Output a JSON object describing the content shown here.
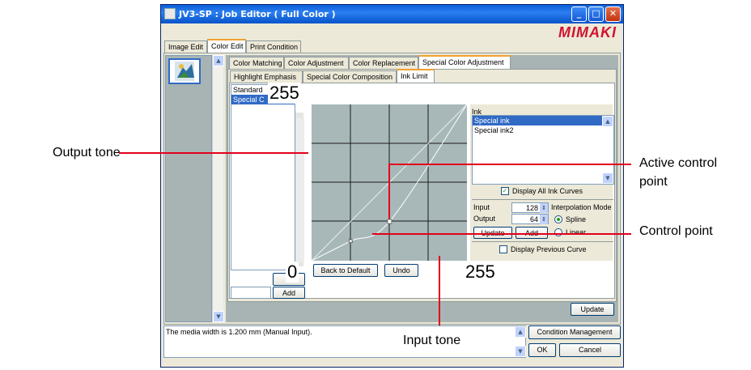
{
  "window": {
    "title": "JV3-SP : Job Editor ( Full Color )",
    "brand": "MIMAKI",
    "min_label": "_",
    "max_label": "□",
    "close_label": "✕"
  },
  "main_tabs": [
    {
      "label": "Image Edit",
      "active": false
    },
    {
      "label": "Color Edit",
      "active": true
    },
    {
      "label": "Print Condition",
      "active": false
    }
  ],
  "sub_tabs": [
    {
      "label": "Color Matching",
      "active": false
    },
    {
      "label": "Color Adjustment",
      "active": false
    },
    {
      "label": "Color Replacement",
      "active": false
    },
    {
      "label": "Special Color Adjustment",
      "active": true
    }
  ],
  "sub_sub_tabs": [
    {
      "label": "Highlight Emphasis",
      "active": false
    },
    {
      "label": "Special Color Composition",
      "active": false
    },
    {
      "label": "Ink Limit",
      "active": true
    }
  ],
  "preset_list": {
    "items": [
      "Standard",
      "Special C"
    ],
    "selected_index": 1,
    "delete_label": "D",
    "add_label": "Add"
  },
  "curve": {
    "min_label": "0",
    "max_label": "255",
    "x_max_label": "255",
    "back_to_default_label": "Back to Default",
    "undo_label": "Undo",
    "control_points": [
      {
        "input": 64,
        "output": 32
      },
      {
        "input": 128,
        "output": 64
      }
    ],
    "active_point_index": 1
  },
  "ink": {
    "header": "Ink",
    "items": [
      "Special ink",
      "Special ink2"
    ],
    "selected_index": 0,
    "display_all_label": "Display All Ink Curves",
    "display_all_checked": true
  },
  "point_editor": {
    "input_label": "Input",
    "input_value": "128",
    "output_label": "Output",
    "output_value": "64",
    "update_label": "Update",
    "add_label": "Add"
  },
  "interpolation": {
    "header": "Interpolation Mode",
    "options": [
      "Spline",
      "Linear"
    ],
    "selected": "Spline"
  },
  "display_previous_label": "Display Previous Curve",
  "display_previous_checked": false,
  "update_label": "Update",
  "status": {
    "message": "The media width is 1.200 mm (Manual Input).",
    "condition_management_label": "Condition Management",
    "ok_label": "OK",
    "cancel_label": "Cancel"
  },
  "callouts": {
    "output_tone": "Output tone",
    "active_control_point_line1": "Active control",
    "active_control_point_line2": "point",
    "control_point": "Control point",
    "input_tone": "Input tone"
  },
  "colors": {
    "callout_line": "#e3001b",
    "graph_bg": "#a8b8b8",
    "selection": "#316ac5",
    "brand": "#d2122e"
  }
}
